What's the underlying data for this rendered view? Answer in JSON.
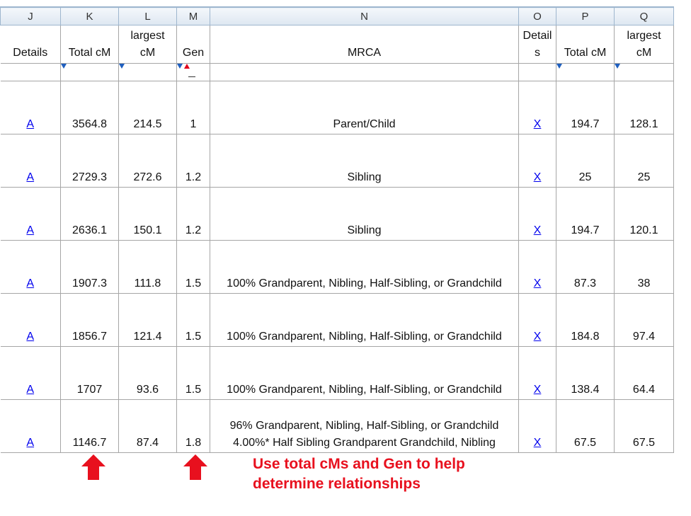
{
  "columns": [
    "J",
    "K",
    "L",
    "M",
    "N",
    "O",
    "P",
    "Q"
  ],
  "headers": {
    "J": "Details",
    "K": "Total cM",
    "L_line1": "largest",
    "L_line2": "cM",
    "M": "Gen",
    "N": "MRCA",
    "O_line1": "Detail",
    "O_line2": "s",
    "P": "Total cM",
    "Q_line1": "largest",
    "Q_line2": "cM"
  },
  "rows": [
    {
      "details": "A",
      "total": "3564.8",
      "largest": "214.5",
      "gen": "1",
      "mrca": "Parent/Child",
      "mrca2": "",
      "details2": "X",
      "total2": "194.7",
      "largest2": "128.1"
    },
    {
      "details": "A",
      "total": "2729.3",
      "largest": "272.6",
      "gen": "1.2",
      "mrca": "Sibling",
      "mrca2": "",
      "details2": "X",
      "total2": "25",
      "largest2": "25"
    },
    {
      "details": "A",
      "total": "2636.1",
      "largest": "150.1",
      "gen": "1.2",
      "mrca": "Sibling",
      "mrca2": "",
      "details2": "X",
      "total2": "194.7",
      "largest2": "120.1"
    },
    {
      "details": "A",
      "total": "1907.3",
      "largest": "111.8",
      "gen": "1.5",
      "mrca": "100% Grandparent, Nibling, Half-Sibling, or Grandchild",
      "mrca2": "",
      "details2": "X",
      "total2": "87.3",
      "largest2": "38"
    },
    {
      "details": "A",
      "total": "1856.7",
      "largest": "121.4",
      "gen": "1.5",
      "mrca": "100% Grandparent, Nibling, Half-Sibling, or Grandchild",
      "mrca2": "",
      "details2": "X",
      "total2": "184.8",
      "largest2": "97.4"
    },
    {
      "details": "A",
      "total": "1707",
      "largest": "93.6",
      "gen": "1.5",
      "mrca": "100% Grandparent, Nibling, Half-Sibling, or Grandchild",
      "mrca2": "",
      "details2": "X",
      "total2": "138.4",
      "largest2": "64.4"
    },
    {
      "details": "A",
      "total": "1146.7",
      "largest": "87.4",
      "gen": "1.8",
      "mrca": "96% Grandparent, Nibling, Half-Sibling, or Grandchild",
      "mrca2": "4.00%* Half Sibling Grandparent Grandchild, Nibling",
      "details2": "X",
      "total2": "67.5",
      "largest2": "67.5"
    }
  ],
  "annotation": {
    "line1": "Use total cMs and Gen to help",
    "line2": "determine relationships"
  },
  "colors": {
    "link": "#0000ee",
    "annotation": "#e8101e",
    "filter_arrow": "#1f5fbf"
  }
}
